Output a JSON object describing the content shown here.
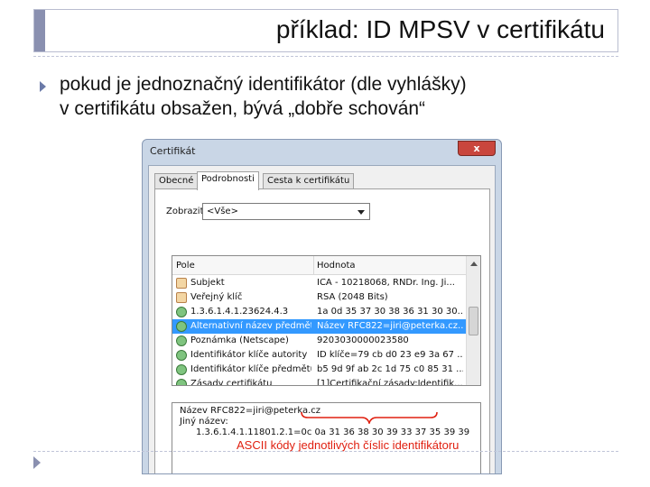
{
  "slide": {
    "title": "příklad: ID MPSV v certifikátu",
    "bullet_line1": "pokud je jednoznačný identifikátor (dle vyhlášky)",
    "bullet_line2": "v  certifikátu obsažen, bývá „dobře schován“",
    "annotation": "ASCII kódy jednotlivých  číslic identifikátoru",
    "accent_color": "#8a90b0",
    "annotation_color": "#e02010"
  },
  "dialog": {
    "title": "Certifikát",
    "close_glyph": "x",
    "tabs": [
      {
        "label": "Obecné"
      },
      {
        "label": "Podrobnosti"
      },
      {
        "label": "Cesta k certifikátu"
      }
    ],
    "show_label": "Zobrazit:",
    "show_value": "<Vše>",
    "columns": {
      "field": "Pole",
      "value": "Hodnota"
    },
    "rows": [
      {
        "icon": "certificate-field-icon",
        "field": "Subjekt",
        "value": "ICA - 10218068, RNDr. Ing. Ji..."
      },
      {
        "icon": "certificate-field-icon",
        "field": "Veřejný klíč",
        "value": "RSA (2048 Bits)"
      },
      {
        "icon": "extension-icon",
        "field": "1.3.6.1.4.1.23624.4.3",
        "value": "1a 0d 35 37 30 38 36 31 30 30..."
      },
      {
        "icon": "extension-icon",
        "field": "Alternativní název předmětu",
        "value": "Název RFC822=jiri@peterka.cz..."
      },
      {
        "icon": "extension-icon",
        "field": "Poznámka (Netscape)",
        "value": "9203030000023580"
      },
      {
        "icon": "extension-icon",
        "field": "Identifikátor klíče autority",
        "value": "ID klíče=79 cb d0 23 e9 3a 67 ..."
      },
      {
        "icon": "extension-icon",
        "field": "Identifikátor klíče předmětu",
        "value": "b5 9d 9f ab 2c 1d 75 c0 85 31 ..."
      },
      {
        "icon": "extension-icon",
        "field": "Zásady certifikátu",
        "value": "[1]Certifikační zásady:Identifik..."
      }
    ],
    "selected_row": 3,
    "detail": {
      "line1": "Název RFC822=jiri@peterka.cz",
      "line2": "Jiný název:",
      "line3": "1.3.6.1.4.1.11801.2.1=0c 0a 31 36 38 30 39 33 37 35 39 39"
    },
    "selection_color": "#3399ff"
  }
}
